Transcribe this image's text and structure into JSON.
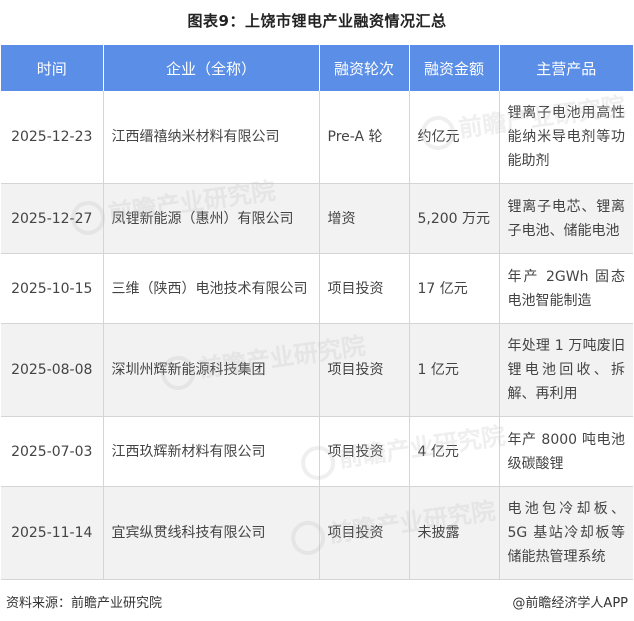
{
  "title": "图表9：上饶市锂电产业融资情况汇总",
  "headers": {
    "time": "时间",
    "company": "企业（全称）",
    "round": "融资轮次",
    "amount": "融资金额",
    "product": "主营产品"
  },
  "rows": [
    {
      "time": "2025-12-23",
      "company": "江西缙禧纳米材料有限公司",
      "round": "Pre-A 轮",
      "amount": "约亿元",
      "product": "锂离子电池用高性能纳米导电剂等功能助剂"
    },
    {
      "time": "2025-12-27",
      "company": "凤锂新能源（惠州）有限公司",
      "round": "增资",
      "amount": "5,200 万元",
      "product": "锂离子电芯、锂离子电池、储能电池"
    },
    {
      "time": "2025-10-15",
      "company": "三维（陕西）电池技术有限公司",
      "round": "项目投资",
      "amount": "17 亿元",
      "product": "年产 2GWh 固态电池智能制造"
    },
    {
      "time": "2025-08-08",
      "company": "深圳州辉新能源科技集团",
      "round": "项目投资",
      "amount": "1 亿元",
      "product": "年处理 1 万吨废旧锂电池回收、拆解、再利用"
    },
    {
      "time": "2025-07-03",
      "company": "江西玖辉新材料有限公司",
      "round": "项目投资",
      "amount": "4 亿元",
      "product": "年产 8000 吨电池级碳酸锂"
    },
    {
      "time": "2025-11-14",
      "company": "宜宾纵贯线科技有限公司",
      "round": "项目投资",
      "amount": "未披露",
      "product": "电池包冷却板、5G 基站冷却板等储能热管理系统"
    }
  ],
  "watermark": "前瞻产业研究院",
  "footer": {
    "source": "资料来源：前瞻产业研究院",
    "brand": "@前瞻经济学人APP"
  }
}
